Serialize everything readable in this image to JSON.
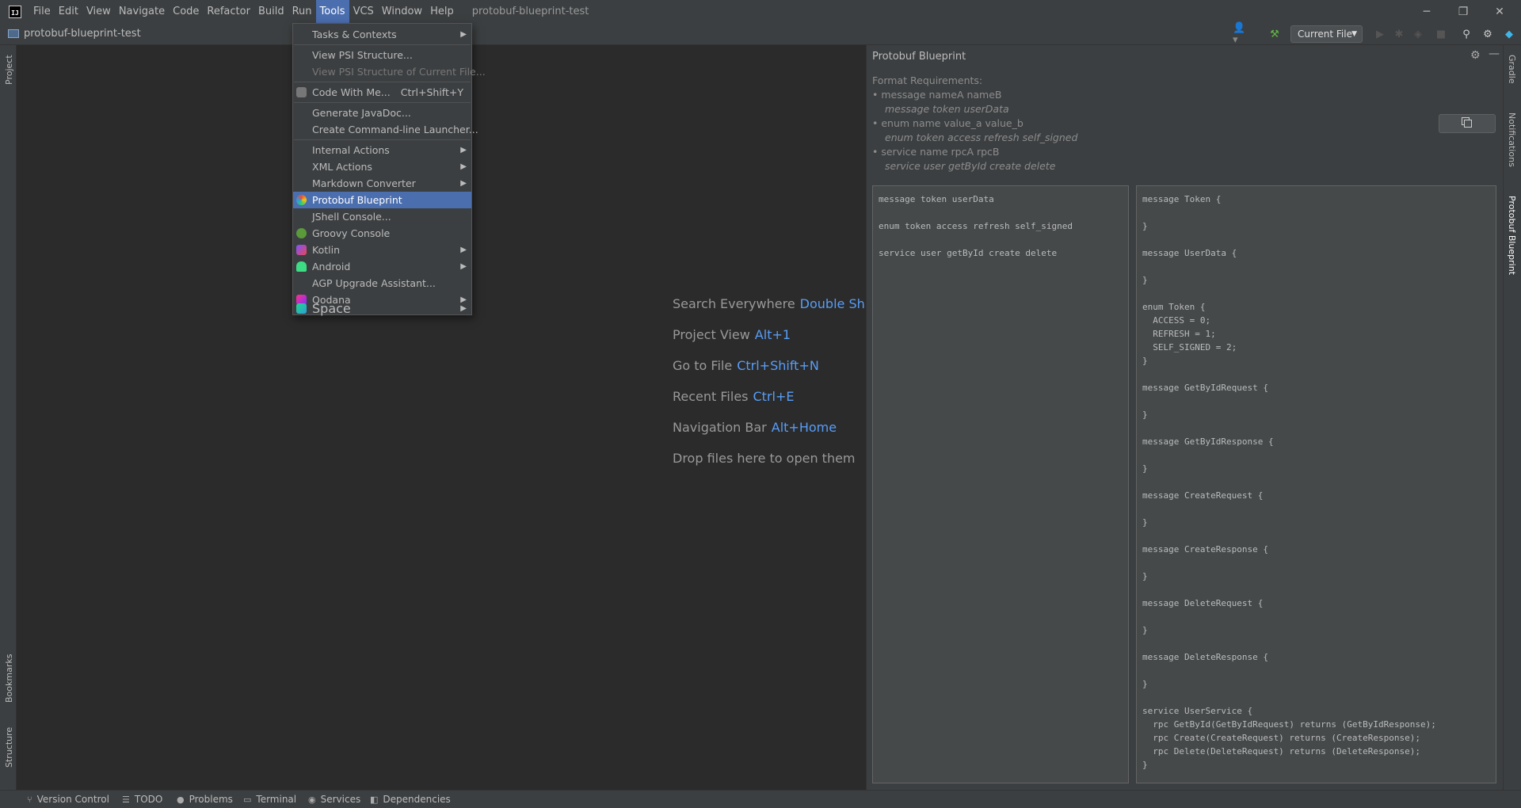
{
  "titlebar": {
    "logo": "IJ",
    "menus": [
      "File",
      "Edit",
      "View",
      "Navigate",
      "Code",
      "Refactor",
      "Build",
      "Run",
      "Tools",
      "VCS",
      "Window",
      "Help"
    ],
    "active_menu": "Tools",
    "project_title": "protobuf-blueprint-test",
    "window_controls": [
      "minimize-icon",
      "restore-icon",
      "close-icon"
    ]
  },
  "navbar": {
    "breadcrumb": "protobuf-blueprint-test",
    "run_config": "Current File",
    "icons": [
      "user-icon",
      "hammer-icon",
      "run-icon",
      "debug-icon",
      "coverage-icon",
      "stop-icon",
      "search-icon",
      "settings-icon",
      "jetbrains-icon"
    ]
  },
  "left_stripe": {
    "project": "Project",
    "bookmarks": "Bookmarks",
    "structure": "Structure"
  },
  "right_stripe": {
    "gradle": "Gradle",
    "notifications": "Notifications",
    "protobuf": "Protobuf Blueprint"
  },
  "editor_hints": [
    {
      "label": "Search Everywhere",
      "key": "Double Shift"
    },
    {
      "label": "Project View",
      "key": "Alt+1"
    },
    {
      "label": "Go to File",
      "key": "Ctrl+Shift+N"
    },
    {
      "label": "Recent Files",
      "key": "Ctrl+E"
    },
    {
      "label": "Navigation Bar",
      "key": "Alt+Home"
    },
    {
      "label": "Drop files here to open them",
      "key": ""
    }
  ],
  "tools_menu": {
    "items": [
      {
        "label": "Tasks & Contexts",
        "submenu": true
      },
      {
        "label": "View PSI Structure..."
      },
      {
        "label": "View PSI Structure of Current File...",
        "disabled": true
      },
      {
        "label": "Code With Me...",
        "shortcut": "Ctrl+Shift+Y",
        "icon": "code-with-me-icon"
      },
      {
        "label": "Generate JavaDoc..."
      },
      {
        "label": "Create Command-line Launcher..."
      },
      {
        "label": "Internal Actions",
        "submenu": true
      },
      {
        "label": "XML Actions",
        "submenu": true
      },
      {
        "label": "Markdown Converter",
        "submenu": true
      },
      {
        "label": "Protobuf Blueprint",
        "selected": true,
        "icon": "protobuf-blueprint-icon"
      },
      {
        "label": "JShell Console..."
      },
      {
        "label": "Groovy Console",
        "icon": "groovy-icon"
      },
      {
        "label": "Kotlin",
        "submenu": true,
        "icon": "kotlin-icon"
      },
      {
        "label": "Android",
        "submenu": true,
        "icon": "android-icon"
      },
      {
        "label": "AGP Upgrade Assistant..."
      },
      {
        "label": "Qodana",
        "submenu": true,
        "icon": "qodana-icon"
      },
      {
        "label": "Space",
        "submenu": true,
        "icon": "space-icon"
      }
    ]
  },
  "protobuf_panel": {
    "title": "Protobuf Blueprint",
    "format_heading": "Format Requirements:",
    "requirements": [
      {
        "rule": "• message nameA nameB",
        "example": "message token userData"
      },
      {
        "rule": "• enum name value_a value_b",
        "example": "enum token access refresh self_signed"
      },
      {
        "rule": "• service name rpcA rpcB",
        "example": "service user getById create delete"
      }
    ],
    "input_text": "message token userData\n\nenum token access refresh self_signed\n\nservice user getById create delete",
    "output_text": "message Token {\n\n}\n\nmessage UserData {\n\n}\n\nenum Token {\n  ACCESS = 0;\n  REFRESH = 1;\n  SELF_SIGNED = 2;\n}\n\nmessage GetByIdRequest {\n\n}\n\nmessage GetByIdResponse {\n\n}\n\nmessage CreateRequest {\n\n}\n\nmessage CreateResponse {\n\n}\n\nmessage DeleteRequest {\n\n}\n\nmessage DeleteResponse {\n\n}\n\nservice UserService {\n  rpc GetById(GetByIdRequest) returns (GetByIdResponse);\n  rpc Create(CreateRequest) returns (CreateResponse);\n  rpc Delete(DeleteRequest) returns (DeleteResponse);\n}"
  },
  "statusbar": {
    "items": [
      {
        "label": "Version Control",
        "icon": "branch-icon"
      },
      {
        "label": "TODO",
        "icon": "list-icon"
      },
      {
        "label": "Problems",
        "icon": "problems-icon"
      },
      {
        "label": "Terminal",
        "icon": "terminal-icon"
      },
      {
        "label": "Services",
        "icon": "services-icon"
      },
      {
        "label": "Dependencies",
        "icon": "dependencies-icon"
      }
    ]
  }
}
